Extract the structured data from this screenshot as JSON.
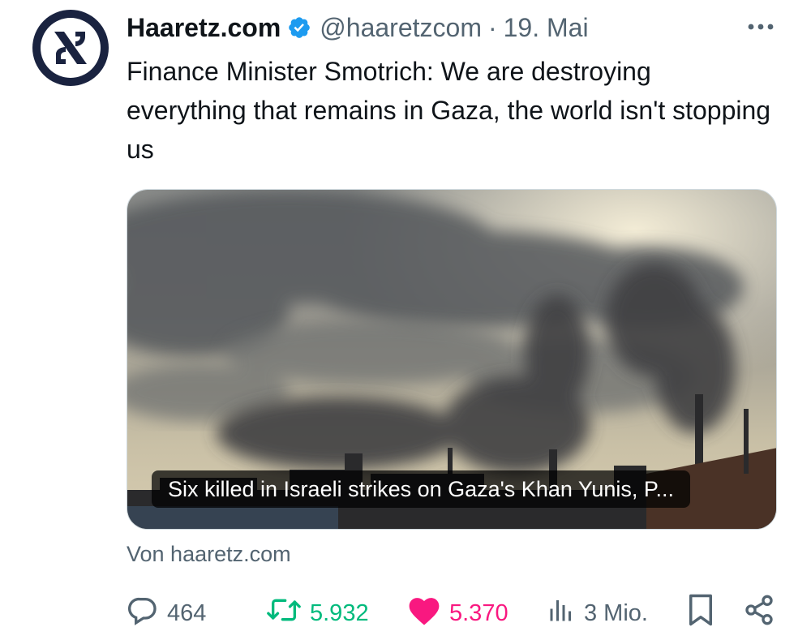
{
  "author": {
    "name": "Haaretz.com",
    "handle": "@haaretzcom",
    "separator": "·",
    "date": "19. Mai",
    "avatar_icon": "haaretz-aleph-logo",
    "verified_icon": "verified-badge-icon"
  },
  "tweet": {
    "text": "Finance Minister Smotrich: We are destroying everything that remains in Gaza, the world isn't stopping us"
  },
  "card": {
    "caption": "Six killed in Israeli strikes on Gaza's Khan Yunis, P...",
    "image_icon": "smoke-over-city-photo",
    "source": "Von haaretz.com"
  },
  "actions": {
    "replies": {
      "icon": "reply-icon",
      "count": "464"
    },
    "reposts": {
      "icon": "repost-icon",
      "count": "5.932",
      "color": "#00ba7c"
    },
    "likes": {
      "icon": "heart-icon",
      "count": "5.370",
      "color": "#f91880"
    },
    "views": {
      "icon": "views-icon",
      "count": "3 Mio."
    },
    "bookmark": {
      "icon": "bookmark-icon"
    },
    "share": {
      "icon": "share-icon"
    }
  },
  "colors": {
    "text": "#0f1419",
    "secondary": "#536471",
    "verified": "#1d9bf0",
    "avatar_ring": "#1a2340"
  }
}
